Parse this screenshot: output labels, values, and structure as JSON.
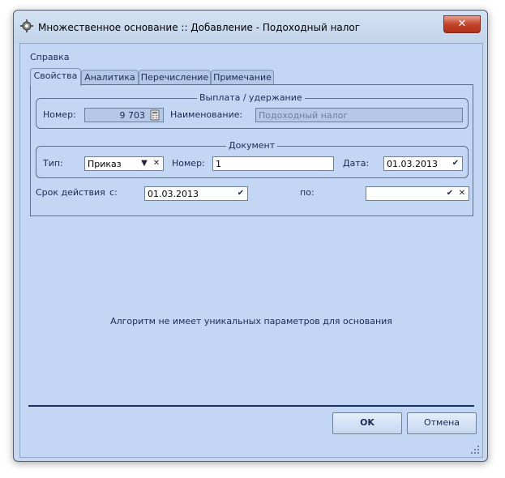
{
  "window": {
    "title": "Множественное основание :: Добавление - Подоходный налог",
    "close_label": "✕"
  },
  "menu": {
    "items": [
      "Справка"
    ]
  },
  "tabs": [
    "Свойства",
    "Аналитика",
    "Перечисление",
    "Примечание"
  ],
  "payment_group": {
    "title": "Выплата / удержание",
    "number_label": "Номер:",
    "number_value": "9 703",
    "name_label": "Наименование:",
    "name_value": "Подоходный налог"
  },
  "document_group": {
    "title": "Документ",
    "type_label": "Тип:",
    "type_value": "Приказ",
    "number_label": "Номер:",
    "number_value": "1",
    "date_label": "Дата:",
    "date_value": "01.03.2013"
  },
  "validity": {
    "label": "Срок действия",
    "from_label": "с:",
    "from_value": "01.03.2013",
    "to_label": "по:",
    "to_value": ""
  },
  "message": "Алгоритм не имеет уникальных параметров для основания",
  "buttons": {
    "ok": "OK",
    "cancel": "Отмена"
  },
  "icons": {
    "app": "gear-icon",
    "calc": "calculator-icon",
    "dropdown": "triangle-down-icon",
    "clear": "x-icon",
    "check": "checkmark-icon"
  }
}
